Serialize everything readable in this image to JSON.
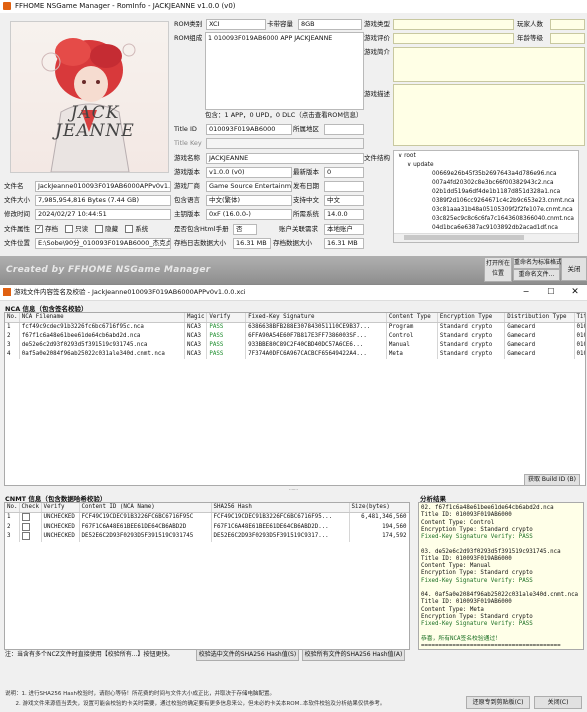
{
  "top_window": {
    "title": "FFHOME NSGame Manager  -  RomInfo  -  JACKJEANNE v1.0.0 (v0)",
    "cover_text": "JACK JEANNE",
    "labels": {
      "rom_type": "ROM类别",
      "cart_size": "卡带容量",
      "rom_composition": "ROM组成",
      "title_id": "Title ID",
      "region": "所属地区",
      "title_key": "Title Key",
      "game_name": "游戏名称",
      "game_version": "游戏版本",
      "latest_version": "最新版本",
      "publisher": "游戏厂商",
      "release_date": "发布日期",
      "language": "包含语言",
      "support_lang": "支持中文",
      "master_key": "主钥版本",
      "firmware": "所需系统",
      "html_manual": "是否包含Html手册",
      "account_req": "账户关联需求",
      "min_storage": "存档日志数据大小",
      "max_storage": "存档数据大小",
      "file_name": "文件名",
      "file_size": "文件大小",
      "modified": "修改时间",
      "file_attr": "文件属性",
      "file_location": "文件位置",
      "game_type": "游戏类型",
      "game_rating": "游戏评价",
      "game_intro": "游戏简介",
      "game_desc": "游戏描述",
      "file_struct": "文件结构",
      "players": "玩家人数",
      "age_rating": "年龄等级"
    },
    "values": {
      "rom_type": "XCI",
      "cart_size": "8GB",
      "rom_composition": "1   010093F019AB6000   APP   JACKJEANNE",
      "content_summary": "包含：1 APP，0 UPD，0 DLC（点击查看ROM信息）",
      "title_id": "010093F019AB6000",
      "region": "",
      "title_key": "",
      "game_name": "JACKJEANNE",
      "game_version": "v1.0.0 (v0)",
      "latest_version": "0",
      "publisher": "Game Source Entertainment",
      "release_date": "",
      "language": "中文(繁体)",
      "support_lang": "中文",
      "master_key": "0xF (16.0.0-)",
      "firmware": "14.0.0",
      "html_manual": "否",
      "account_req": "本地账户",
      "min_storage": "16.31 MB",
      "max_storage": "16.31 MB",
      "file_name": "JackJeanne010093F019AB6000APPv0v1.0.0.xci",
      "file_size": "7,985,954,816 Bytes (7.44 GB)",
      "modified": "2024/02/27 10:44:51",
      "file_location": "E:\\Sobe\\90分_010093F019AB6000_杰克贞娜"
    },
    "attributes": [
      {
        "label": "存档",
        "checked": true
      },
      {
        "label": "只读",
        "checked": false
      },
      {
        "label": "隐藏",
        "checked": false
      },
      {
        "label": "系统",
        "checked": false
      }
    ],
    "file_tree": [
      {
        "text": "root",
        "indent": 0,
        "expander": "∨"
      },
      {
        "text": "update",
        "indent": 1,
        "expander": "∨"
      },
      {
        "text": "00669e26b45f35b2697643a4d786e96.nca",
        "indent": 2
      },
      {
        "text": "007a4fd20302c8e3bc66f00382943c2.nca",
        "indent": 2
      },
      {
        "text": "02b1dd519a6df4de1b1187d851d328a1.nca",
        "indent": 2
      },
      {
        "text": "0389f2d106cc9264671c4c2b9c653e23.cnmt.nca",
        "indent": 2
      },
      {
        "text": "03c81aaa31b48a05105309f2f2fe107e.cnmt.nca",
        "indent": 2
      },
      {
        "text": "03c825ec9c8c6c6fa7c1643608366040.cnmt.nca",
        "indent": 2
      },
      {
        "text": "04d1bca6e6387ac9103892db2acad1df.nca",
        "indent": 2
      }
    ],
    "watermark": "Created by FFHOME NSGame Manager",
    "buttons": {
      "open_location": "打开所在位置",
      "rename_standard": "重命名为标准格式",
      "rename_file": "重命名文件...",
      "close": "关闭"
    }
  },
  "verify_window": {
    "title": "游戏文件内容签名及校验 - JackJeanne010093F019AB6000APPv0v1.0.0.xci",
    "nca_section_title": "NCA 信息（包含签名校验）",
    "nca_columns": [
      "No.",
      "NCA Filename",
      "Magic",
      "Verify",
      "Fixed-Key Signature",
      "Content Type",
      "Encryption Type",
      "Distribution Type",
      "Tit"
    ],
    "nca_rows": [
      [
        "1",
        "fcf49c9cdec91b3226fc6bc6716f95c.nca",
        "NCA3",
        "PASS",
        "6386638BFB288E307843051110CE9B37...",
        "Program",
        "Standard crypto",
        "Gamecard",
        "010"
      ],
      [
        "2",
        "f67f1c6a48e61bee61de64cb6abd2d.nca",
        "NCA3",
        "PASS",
        "6FFA90A54E60F7B817E3FF7386003SF...",
        "Control",
        "Standard crypto",
        "Gamecard",
        "010"
      ],
      [
        "3",
        "de52e6c2d93f0293d5f391519c931745.nca",
        "NCA3",
        "PASS",
        "933BBE80C89C2F40CBD40DC57A6CE6...",
        "Manual",
        "Standard crypto",
        "Gamecard",
        "010"
      ],
      [
        "4",
        "0af5a0e2084f96ab25022c031ale340d.cnmt.nca",
        "NCA3",
        "PASS",
        "7F374A0DFC6A967CACBCF65649422A4...",
        "Meta",
        "Standard crypto",
        "Gamecard",
        "010"
      ]
    ],
    "get_build_id": "获取 Build ID (B)",
    "cnmt_section_title": "CNMT 信息（包含数据哈希校验）",
    "cnmt_columns": [
      "No.",
      "Check",
      "Verify",
      "Content ID (NCA Name)",
      "SHA256 Hash",
      "Size(bytes)"
    ],
    "cnmt_rows": [
      [
        "1",
        "",
        "UNCHECKED",
        "FCF49C19CDEC91B3226FC6BC6716F95C",
        "FCF49C19CDEC91B3226FC6BC6716F95...",
        "6,481,346,560"
      ],
      [
        "2",
        "",
        "UNCHECKED",
        "F67F1C6A48E61BEE61DE64CB6ABD2D",
        "F67F1C6A48E61BEE61DE64CB6ABD2D...",
        "194,560"
      ],
      [
        "3",
        "",
        "UNCHECKED",
        "DE52E6C2D93F0293D5F391519C931745",
        "DE52E6C2D93F0293D5F391519C9317...",
        "174,592"
      ]
    ],
    "analysis_title": "分析结果",
    "analysis_lines": [
      "02. f67f1c6a48e61bee61de64cb6abd2d.nca",
      "Title ID: 010093F019AB6000",
      "Content Type: Control",
      "Encryption Type: Standard crypto",
      "Fixed-Key Signature Verify: PASS",
      "",
      "03. de52e6c2d93f0293d5f391519c931745.nca",
      "Title ID: 010093F019AB6000",
      "Content Type: Manual",
      "Encryption Type: Standard crypto",
      "Fixed-Key Signature Verify: PASS",
      "",
      "04. 0af5a0e2084f96ab25022c031ale340d.cnmt.nca",
      "Title ID: 010093F019AB6000",
      "Content Type: Meta",
      "Encryption Type: Standard crypto",
      "Fixed-Key Signature Verify: PASS",
      "",
      "恭喜，所有NCA签名校验通过！",
      "========================================"
    ],
    "note": "注：当含有多个NCZ文件时直接使用【校验所有...】按钮更快。",
    "btn_verify_selected": "校验选中文件的SHA256 Hash值(S)",
    "btn_verify_all": "校验所有文件的SHA256 Hash值(A)",
    "footer_lines": [
      "说明：1. 进行SHA256 Hash校验时，请耐心等待！所花费的时间与文件大小成正比，并取决于存储电脑配置。",
      "      2. 游戏文件来源值当丢失，设置可能会校验的卡关时需要，通过校验的确定要有更多信息来公，但未必的卡关本ROM..本软件校验及分析结果仅供参考。"
    ],
    "btn_copy": "还原专到剪贴板(C)",
    "btn_close": "关闭(C)"
  }
}
